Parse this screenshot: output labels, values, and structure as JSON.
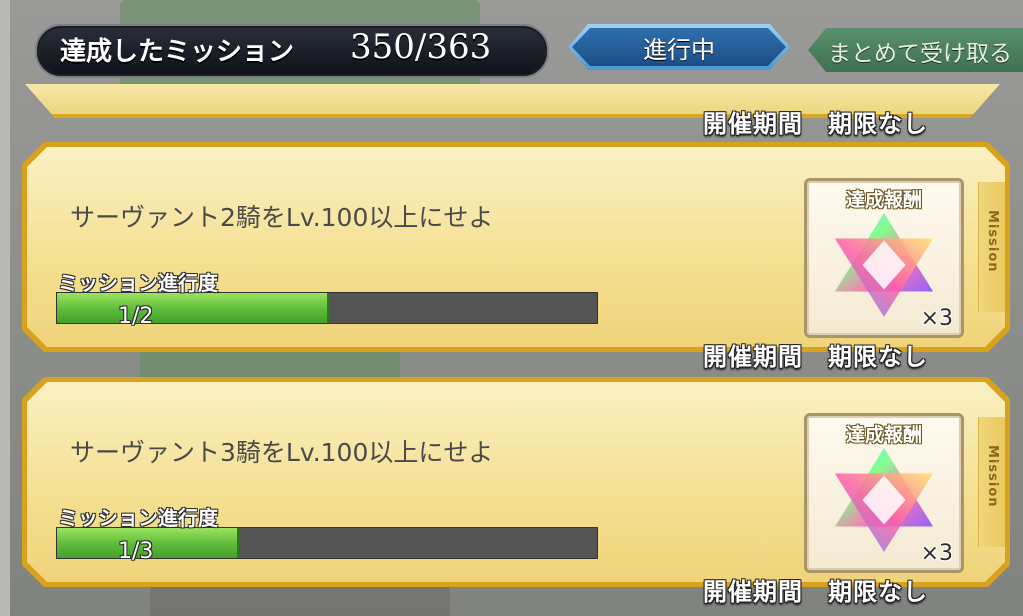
{
  "header": {
    "achieved_label": "達成したミッション",
    "achieved_count": "350/363",
    "active_tab": "進行中",
    "receive_all": "まとめて受け取る"
  },
  "period_label": "開催期間　期限なし",
  "side_tab_text": "Mission",
  "missions": [
    {
      "text": "サーヴァント2騎をLv.100以上にせよ",
      "progress_label": "ミッション進行度",
      "progress_text": "1/2",
      "progress_fraction": 0.5,
      "reward_title": "達成報酬",
      "reward_icon": "saint-quartz-icon",
      "reward_qty": "×3",
      "period": "開催期間　期限なし"
    },
    {
      "text": "サーヴァント3騎をLv.100以上にせよ",
      "progress_label": "ミッション進行度",
      "progress_text": "1/3",
      "progress_fraction": 0.333,
      "reward_title": "達成報酬",
      "reward_icon": "saint-quartz-icon",
      "reward_qty": "×3",
      "period": "開催期間　期限なし"
    }
  ],
  "colors": {
    "card_frame": "#d8a21c",
    "progress_fill": "#5dbb3a",
    "active_tab": "#2f6fae"
  }
}
